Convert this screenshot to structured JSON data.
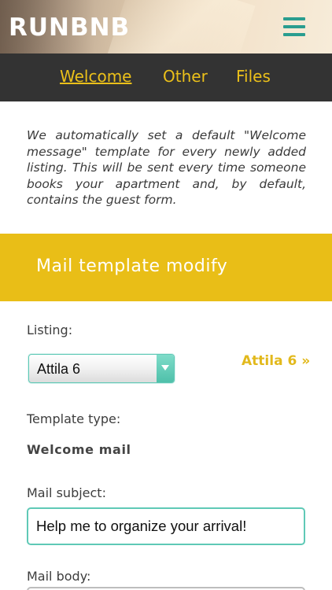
{
  "header": {
    "logo": "RUNBNB",
    "menu_icon": "hamburger-menu-icon",
    "menu_color": "#2a9d8f"
  },
  "tabs": [
    {
      "label": "Welcome",
      "active": true
    },
    {
      "label": "Other",
      "active": false
    },
    {
      "label": "Files",
      "active": false
    }
  ],
  "intro": {
    "text": "We automatically set a default \"Welcome message\" template for every newly added listing. This will be sent every time someone books your apartment and, by default, contains the guest form."
  },
  "banner": {
    "title": "Mail template modify",
    "color": "#e9be17"
  },
  "form": {
    "listing_label": "Listing:",
    "listing_selected": "Attila 6",
    "listing_link": "Attila 6 »",
    "template_type_label": "Template type:",
    "template_type_value": "Welcome mail",
    "subject_label": "Mail subject:",
    "subject_value": "Help me to organize your arrival!",
    "body_label": "Mail body:"
  },
  "colors": {
    "accent_yellow": "#e9be17",
    "accent_teal": "#5fc9b6",
    "nav_bg": "#333333"
  }
}
